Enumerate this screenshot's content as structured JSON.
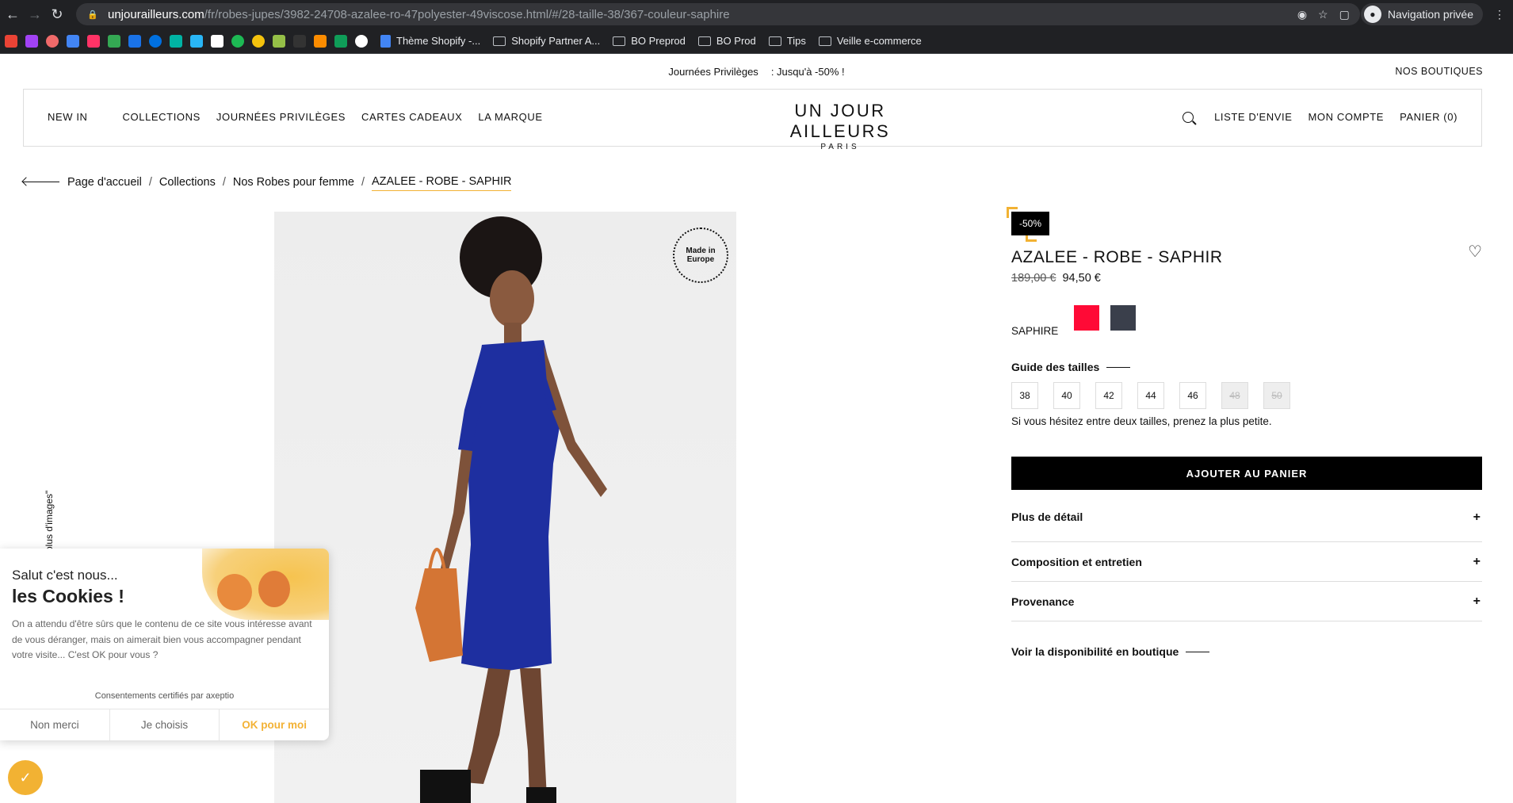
{
  "browser": {
    "url_domain": "unjourailleurs.com",
    "url_path": "/fr/robes-jupes/3982-24708-azalee-ro-47polyester-49viscose.html/#/28-taille-38/367-couleur-saphire",
    "private_label": "Navigation privée"
  },
  "bookmarks": [
    {
      "label": "Thème Shopify -..."
    },
    {
      "label": "Shopify Partner A..."
    },
    {
      "label": "BO Preprod"
    },
    {
      "label": "BO Prod"
    },
    {
      "label": "Tips"
    },
    {
      "label": "Veille e-commerce"
    }
  ],
  "promo": {
    "left": "Journées Privilèges",
    "right": ": Jusqu'à -50% !",
    "stores": "NOS BOUTIQUES"
  },
  "nav": {
    "new_in": "NEW IN",
    "collections": "COLLECTIONS",
    "journees": "JOURNÉES PRIVILÈGES",
    "cartes": "CARTES CADEAUX",
    "marque": "LA MARQUE",
    "wishlist": "LISTE D'ENVIE",
    "account": "MON COMPTE",
    "cart": "PANIER (0)"
  },
  "logo": {
    "line1": "UN JOUR AILLEURS",
    "line2": "PARIS"
  },
  "breadcrumb": {
    "home": "Page d'accueil",
    "collections": "Collections",
    "category": "Nos Robes pour femme",
    "current": "AZALEE - ROBE - SAPHIR",
    "sep": "/"
  },
  "photo": {
    "badge_line1": "Made in",
    "badge_line2": "Europe",
    "side_text": "plus d'images\""
  },
  "product": {
    "discount": "-50%",
    "title": "AZALEE - ROBE - SAPHIR",
    "old_price": "189,00 €",
    "price": "94,50 €",
    "color_label": "SAPHIRE",
    "swatches": [
      "#ff0a36",
      "#3a3f4b"
    ],
    "size_guide": "Guide des tailles",
    "sizes": [
      "38",
      "40",
      "42",
      "44",
      "46",
      "48",
      "50"
    ],
    "hint": "Si vous hésitez entre deux tailles, prenez la plus petite.",
    "add_to_cart": "AJOUTER AU PANIER",
    "accordion": [
      "Plus de détail",
      "Composition et entretien",
      "Provenance"
    ],
    "store_link": "Voir la disponibilité en boutique"
  },
  "cookie": {
    "hi": "Salut c'est nous...",
    "big": "les Cookies !",
    "text": "On a attendu d'être sûrs que le contenu de ce site vous intéresse avant de vous déranger, mais on aimerait bien vous accompagner pendant votre visite... C'est OK pour vous ?",
    "cert": "Consentements certifiés par axeptio",
    "no": "Non merci",
    "choose": "Je choisis",
    "ok": "OK pour moi"
  }
}
